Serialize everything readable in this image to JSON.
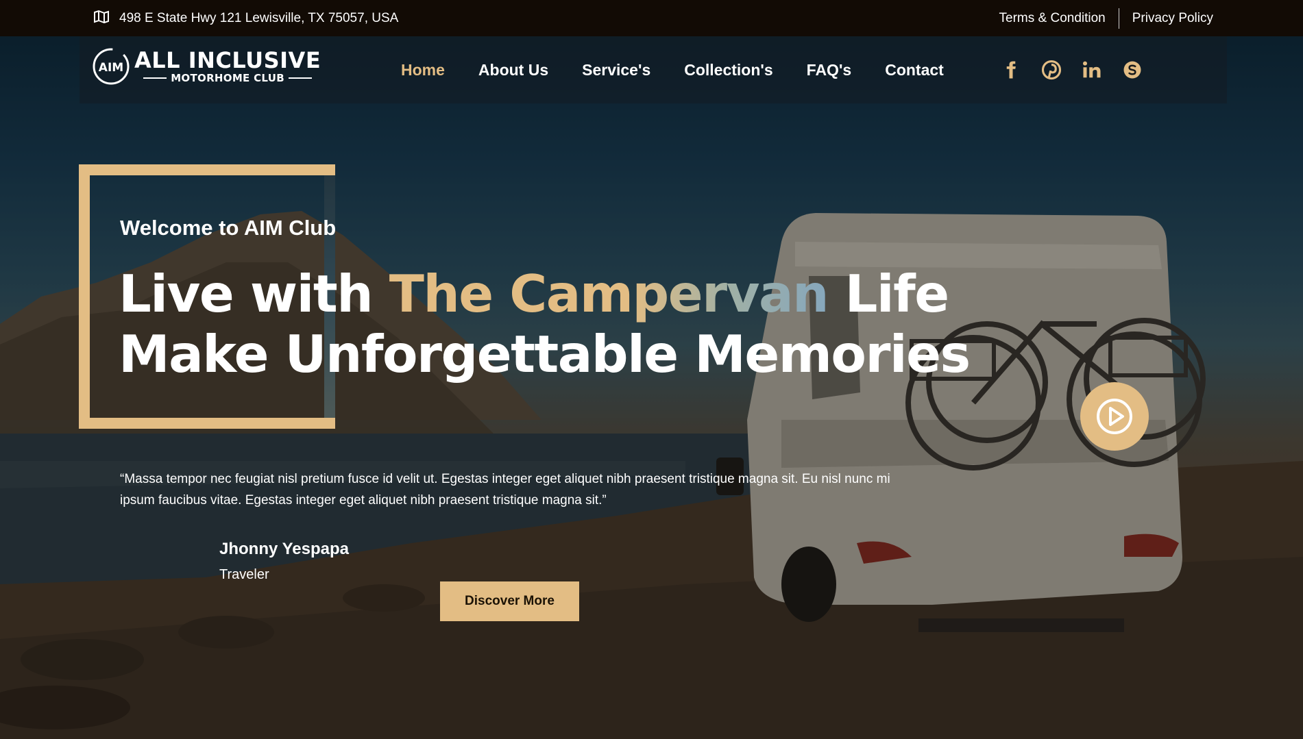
{
  "topbar": {
    "address": "498 E State Hwy 121 Lewisville, TX 75057, USA",
    "links": [
      "Terms & Condition",
      "Privacy Policy"
    ]
  },
  "logo": {
    "badge": "AIM",
    "line1": "ALL INCLUSIVE",
    "line2": "MOTORHOME CLUB"
  },
  "nav": {
    "items": [
      "Home",
      "About Us",
      "Service's",
      "Collection's",
      "FAQ's",
      "Contact"
    ],
    "active": "Home"
  },
  "social": [
    "facebook-icon",
    "pinterest-icon",
    "linkedin-icon",
    "skype-icon"
  ],
  "hero": {
    "welcome": "Welcome to AIM Club",
    "headline": {
      "line1_before": "Live with ",
      "line1_accent": "The Campervan",
      "line1_after": " Life",
      "line2": "Make Unforgettable Memories"
    },
    "quote": "“Massa tempor nec feugiat nisl pretium fusce id velit ut. Egestas integer eget aliquet nibh praesent tristique magna sit. Eu nisl nunc mi ipsum faucibus vitae. Egestas integer eget aliquet nibh praesent tristique magna sit.”",
    "author_name": "Jhonny Yespapa",
    "author_role": "Traveler",
    "cta": "Discover More",
    "play_icon": "play-icon"
  },
  "colors": {
    "accent": "#e3bd84",
    "topbar_bg": "#120b05",
    "text": "#ffffff"
  }
}
